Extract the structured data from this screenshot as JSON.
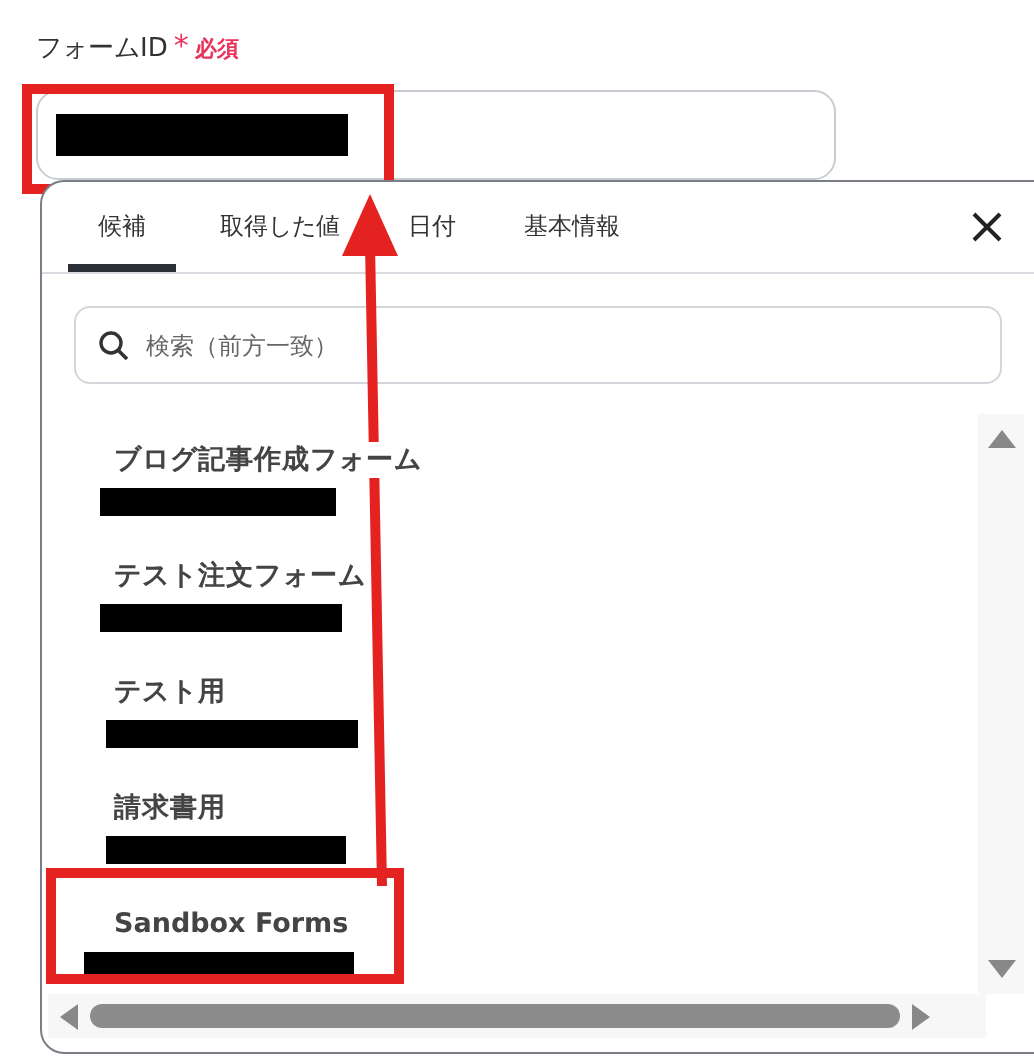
{
  "field": {
    "label": "フォームID",
    "required_mark": "*",
    "required_text": "必須",
    "highlighted": true
  },
  "tabs": [
    {
      "label": "候補",
      "selected": true
    },
    {
      "label": "取得した値",
      "selected": false
    },
    {
      "label": "日付",
      "selected": false
    },
    {
      "label": "基本情報",
      "selected": false
    }
  ],
  "search": {
    "placeholder": "検索（前方一致）"
  },
  "options": [
    {
      "label": "ブログ記事作成フォーム",
      "highlighted": false
    },
    {
      "label": "テスト注文フォーム",
      "highlighted": false
    },
    {
      "label": "テスト用",
      "highlighted": false
    },
    {
      "label": "請求書用",
      "highlighted": false
    },
    {
      "label": "Sandbox Forms",
      "highlighted": true
    }
  ]
}
